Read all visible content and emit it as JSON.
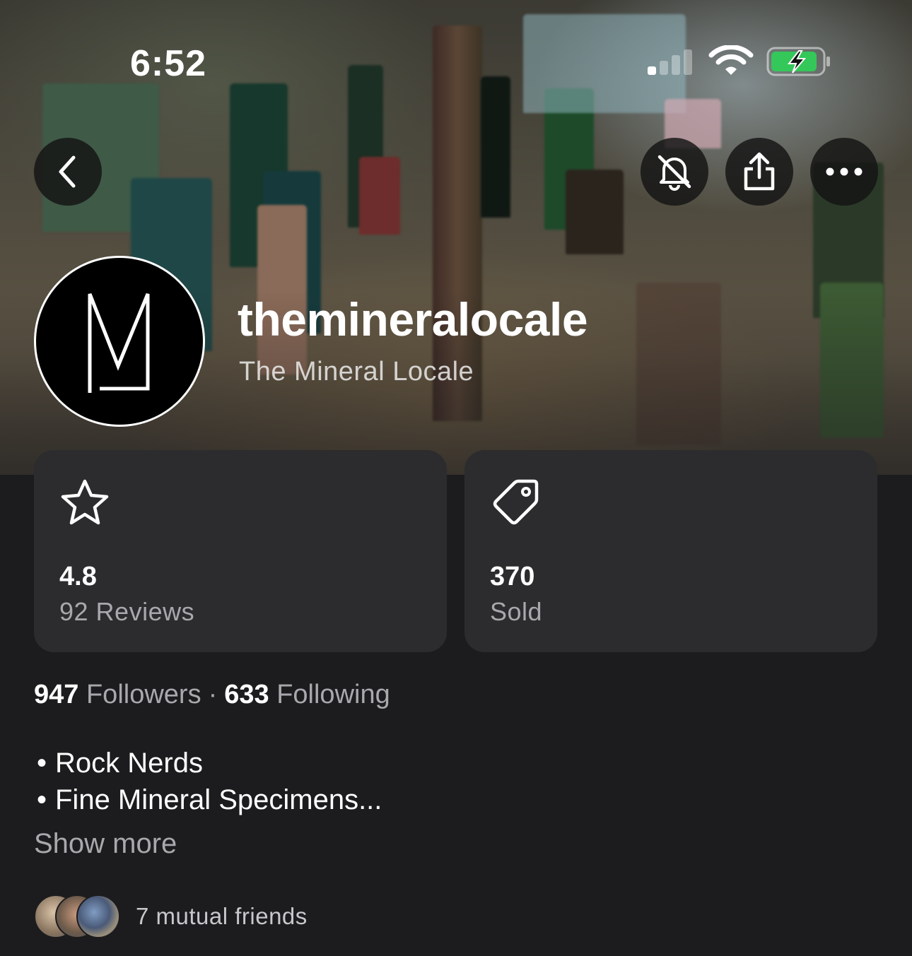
{
  "status_bar": {
    "time": "6:52",
    "signal_bars_active": 1,
    "battery_level": 0.8,
    "battery_charging": true,
    "battery_color": "#34c759"
  },
  "header": {
    "back_icon": "chevron-left-icon",
    "mute_icon": "bell-slash-icon",
    "share_icon": "share-icon",
    "more_icon": "ellipsis-icon"
  },
  "profile": {
    "username": "themineralocale",
    "display_name": "The Mineral Locale",
    "avatar_monogram": "M"
  },
  "stats": [
    {
      "icon": "star-icon",
      "value": "4.8",
      "label": "92 Reviews"
    },
    {
      "icon": "tag-icon",
      "value": "370",
      "label": "Sold"
    }
  ],
  "follow": {
    "followers_count": "947",
    "followers_label": "Followers",
    "separator": "·",
    "following_count": "633",
    "following_label": "Following"
  },
  "bio": {
    "lines": [
      "Rock Nerds",
      "Fine Mineral Specimens..."
    ],
    "bullet": "•",
    "show_more_label": "Show more"
  },
  "mutual": {
    "label": "7 mutual friends"
  },
  "colors": {
    "background": "#1c1c1e",
    "card": "#2c2c2e",
    "secondary_text": "#a8a8ad"
  }
}
